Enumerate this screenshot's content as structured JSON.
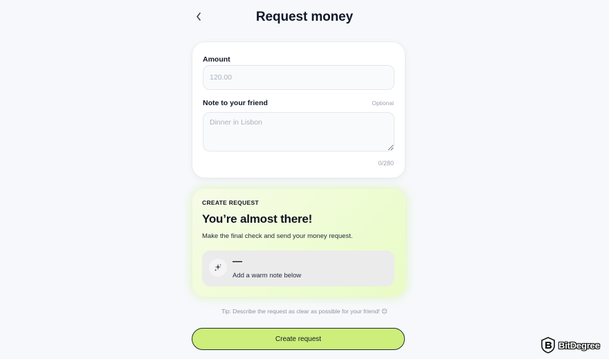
{
  "header": {
    "title": "Request money",
    "back_icon": "chevron-left-icon"
  },
  "form": {
    "amount_label": "Amount",
    "amount_placeholder": "120.00",
    "amount_value": "",
    "note_label": "Note to your friend",
    "note_optional": "Optional",
    "note_placeholder": "Dinner in Lisbon",
    "note_value": "",
    "char_counter": "0/280"
  },
  "summary": {
    "eyebrow": "CREATE REQUEST",
    "heading": "You’re almost there!",
    "subtext": "Make the final check and send your money request.",
    "preview": {
      "icon": "sparkle-icon",
      "amount": "—",
      "note": "Add a warm note below"
    }
  },
  "tip": "Tip: Describe the request as clear as possible for your friend! 😊",
  "actions": {
    "create_label": "Create request"
  },
  "watermark": {
    "text": "BitDegree"
  },
  "colors": {
    "page_bg": "#f6f8fb",
    "card_bg": "#ffffff",
    "accent_green": "#cdee7a",
    "summary_bg": "#eefcd2",
    "text_primary": "#111827",
    "text_muted": "#9ca3af"
  }
}
